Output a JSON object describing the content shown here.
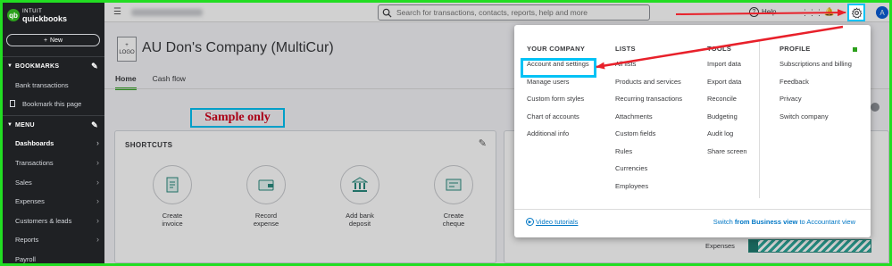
{
  "sidebar": {
    "brand_top": "INTUIT",
    "brand_bottom": "quickbooks",
    "new_label": "New",
    "bookmarks_heading": "BOOKMARKS",
    "bank_transactions": "Bank transactions",
    "bookmark_this_page": "Bookmark this page",
    "menu_heading": "MENU",
    "items": [
      {
        "label": "Dashboards"
      },
      {
        "label": "Transactions"
      },
      {
        "label": "Sales"
      },
      {
        "label": "Expenses"
      },
      {
        "label": "Customers & leads"
      },
      {
        "label": "Reports"
      },
      {
        "label": "Payroll"
      }
    ]
  },
  "topbar": {
    "search_placeholder": "Search for transactions, contacts, reports, help and more",
    "help_label": "Help",
    "avatar_letter": "A"
  },
  "company": {
    "logo_line1": "+",
    "logo_line2": "LOGO",
    "name": "AU Don's Company (MultiCur)"
  },
  "tabs": [
    {
      "label": "Home"
    },
    {
      "label": "Cash flow"
    }
  ],
  "annotation": {
    "sample_text": "Sample only"
  },
  "shortcuts": {
    "title": "SHORTCUTS",
    "items": [
      {
        "label_line1": "Create",
        "label_line2": "invoice"
      },
      {
        "label_line1": "Record",
        "label_line2": "expense"
      },
      {
        "label_line1": "Add bank",
        "label_line2": "deposit"
      },
      {
        "label_line1": "Create",
        "label_line2": "cheque"
      }
    ]
  },
  "expenses_label": "Expenses",
  "settings_menu": {
    "columns": [
      {
        "heading": "YOUR COMPANY",
        "items": [
          "Account and settings",
          "Manage users",
          "Custom form styles",
          "Chart of accounts",
          "Additional info"
        ]
      },
      {
        "heading": "LISTS",
        "items": [
          "All lists",
          "Products and services",
          "Recurring transactions",
          "Attachments",
          "Custom fields",
          "Rules",
          "Currencies",
          "Employees"
        ]
      },
      {
        "heading": "TOOLS",
        "items": [
          "Import data",
          "Export data",
          "Reconcile",
          "Budgeting",
          "Audit log",
          "Share screen"
        ]
      },
      {
        "heading": "PROFILE",
        "items": [
          "Subscriptions and billing",
          "Feedback",
          "Privacy",
          "Switch company"
        ]
      }
    ],
    "video_tutorials": "Video tutorials",
    "switch_prefix": "Switch ",
    "switch_bold": "from Business view",
    "switch_suffix": " to Accountant view"
  },
  "colors": {
    "frame": "#22dd22",
    "highlight": "#00c2f5",
    "arrow": "#e8202a",
    "brand_green": "#2ca01c",
    "link_blue": "#0077c5"
  }
}
